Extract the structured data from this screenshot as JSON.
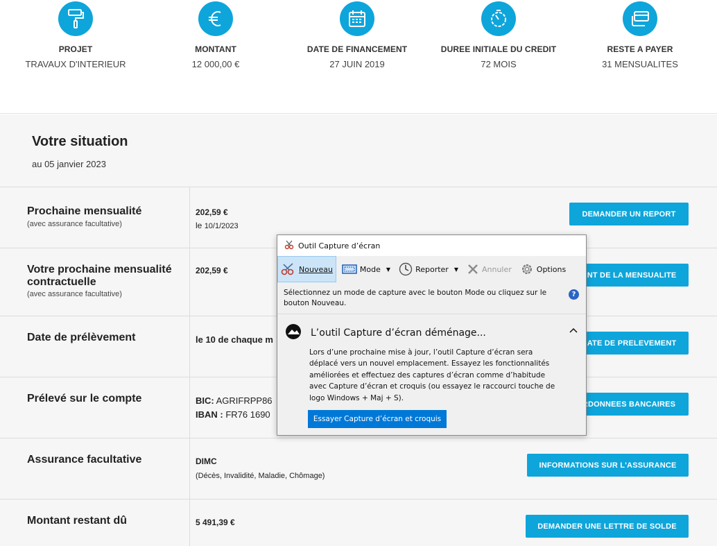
{
  "summary": [
    {
      "label": "PROJET",
      "value": "TRAVAUX D'INTERIEUR",
      "icon": "paint-roller-icon"
    },
    {
      "label": "MONTANT",
      "value": "12 000,00 €",
      "icon": "euro-icon"
    },
    {
      "label": "DATE DE FINANCEMENT",
      "value": "27 JUIN 2019",
      "icon": "calendar-icon"
    },
    {
      "label": "DUREE INITIALE DU CREDIT",
      "value": "72 MOIS",
      "icon": "stopwatch-icon"
    },
    {
      "label": "RESTE A PAYER",
      "value": "31 MENSUALITES",
      "icon": "cards-icon"
    }
  ],
  "situation": {
    "title": "Votre situation",
    "date": "au 05 janvier 2023"
  },
  "rows": {
    "next_payment": {
      "title": "Prochaine mensualité",
      "subtitle": "(avec assurance facultative)",
      "amount": "202,59 €",
      "date_prefix": "le",
      "date": "10/1/2023",
      "button": "DEMANDER UN REPORT"
    },
    "contractual": {
      "title": "Votre prochaine mensualité contractuelle",
      "subtitle": "(avec assurance facultative)",
      "amount": "202,59 €",
      "button": "ANT DE LA MENSUALITE"
    },
    "debit_date": {
      "title": "Date de prélèvement",
      "value": "le 10 de chaque m",
      "button": "DATE DE PRELEVEMENT"
    },
    "account": {
      "title": "Prélevé sur le compte",
      "bic_label": "BIC:",
      "bic": "AGRIFRPP86",
      "iban_label": "IBAN :",
      "iban": "FR76 1690",
      "button": "RDONNEES BANCAIRES"
    },
    "insurance": {
      "title": "Assurance facultative",
      "value": "DIMC",
      "detail": "(Décès, Invalidité, Maladie, Chômage)",
      "button": "INFORMATIONS SUR L'ASSURANCE"
    },
    "remaining": {
      "title": "Montant restant dû",
      "amount": "5 491,39 €",
      "button": "DEMANDER UNE LETTRE DE SOLDE"
    }
  },
  "snip": {
    "window_title": "Outil Capture d’écran",
    "toolbar": {
      "new": "Nouveau",
      "mode": "Mode",
      "delay": "Reporter",
      "cancel": "Annuler",
      "options": "Options"
    },
    "message": "Sélectionnez un mode de capture avec le bouton Mode ou cliquez sur le bouton Nouveau.",
    "heading": "L’outil Capture d’écran déménage...",
    "body": "Lors d’une prochaine mise à jour, l’outil Capture d’écran sera déplacé vers un nouvel emplacement. Essayez les fonctionnalités améliorées et effectuez des captures d’écran comme d’habitude avec Capture d’écran et croquis (ou essayez le raccourci touche de logo Windows + Maj + S).",
    "try_button": "Essayer Capture d’écran et croquis"
  },
  "colors": {
    "accent": "#0ea5db",
    "win_blue": "#0078d7"
  }
}
